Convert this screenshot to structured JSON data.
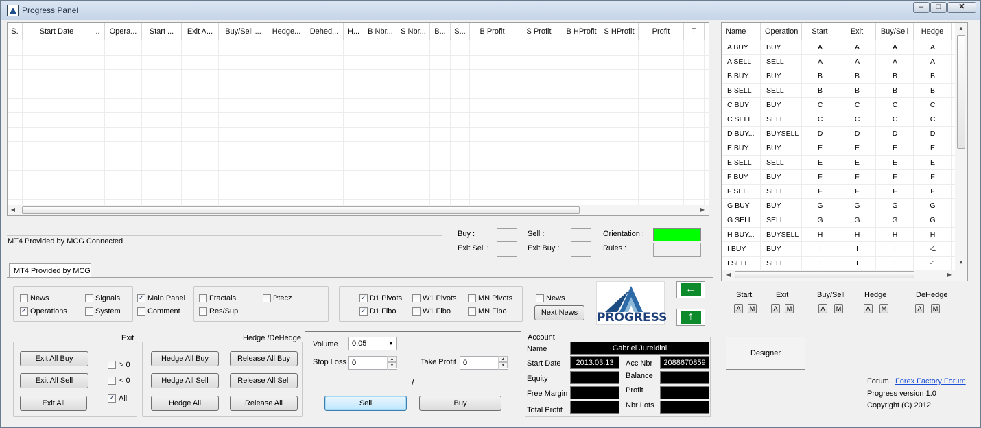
{
  "window": {
    "title": "Progress Panel"
  },
  "positions_grid": {
    "columns": [
      "S.",
      "Start Date",
      "..",
      "Opera...",
      "Start ...",
      "Exit A...",
      "Buy/Sell ...",
      "Hedge...",
      "Dehed...",
      "H...",
      "B Nbr...",
      "S Nbr...",
      "B...",
      "S...",
      "B Profit",
      "S Profit",
      "B HProfit",
      "S HProfit",
      "Profit",
      "T"
    ]
  },
  "rules_grid": {
    "columns": [
      "Name",
      "Operation",
      "Start",
      "Exit",
      "Buy/Sell",
      "Hedge"
    ],
    "rows": [
      [
        "A BUY",
        "BUY",
        "A",
        "A",
        "A",
        "A"
      ],
      [
        "A SELL",
        "SELL",
        "A",
        "A",
        "A",
        "A"
      ],
      [
        "B BUY",
        "BUY",
        "B",
        "B",
        "B",
        "B"
      ],
      [
        "B SELL",
        "SELL",
        "B",
        "B",
        "B",
        "B"
      ],
      [
        "C BUY",
        "BUY",
        "C",
        "C",
        "C",
        "C"
      ],
      [
        "C SELL",
        "SELL",
        "C",
        "C",
        "C",
        "C"
      ],
      [
        "D BUY...",
        "BUYSELL",
        "D",
        "D",
        "D",
        "D"
      ],
      [
        "E BUY",
        "BUY",
        "E",
        "E",
        "E",
        "E"
      ],
      [
        "E SELL",
        "SELL",
        "E",
        "E",
        "E",
        "E"
      ],
      [
        "F BUY",
        "BUY",
        "F",
        "F",
        "F",
        "F"
      ],
      [
        "F SELL",
        "SELL",
        "F",
        "F",
        "F",
        "F"
      ],
      [
        "G BUY",
        "BUY",
        "G",
        "G",
        "G",
        "G"
      ],
      [
        "G SELL",
        "SELL",
        "G",
        "G",
        "G",
        "G"
      ],
      [
        "H BUY...",
        "BUYSELL",
        "H",
        "H",
        "H",
        "H"
      ],
      [
        "I BUY",
        "BUY",
        "I",
        "I",
        "I",
        "-1"
      ],
      [
        "I SELL",
        "SELL",
        "I",
        "I",
        "I",
        "-1"
      ]
    ]
  },
  "status": {
    "connection": "MT4 Provided by MCG Connected"
  },
  "indicators": {
    "buy": "Buy :",
    "sell": "Sell :",
    "exit_sell": "Exit Sell :",
    "exit_buy": "Exit Buy :",
    "orientation": "Orientation :",
    "rules": "Rules :",
    "orientation_color": "#00ff00"
  },
  "tab": {
    "label": "MT4 Provided by MCG"
  },
  "options": {
    "news": {
      "label": "News",
      "checked": false
    },
    "signals": {
      "label": "Signals",
      "checked": false
    },
    "operations": {
      "label": "Operations",
      "checked": true
    },
    "system": {
      "label": "System",
      "checked": false
    },
    "main_panel": {
      "label": "Main Panel",
      "checked": true
    },
    "comment": {
      "label": "Comment",
      "checked": false
    },
    "fractals": {
      "label": "Fractals",
      "checked": false
    },
    "ptecz": {
      "label": "Ptecz",
      "checked": false
    },
    "res_sup": {
      "label": "Res/Sup",
      "checked": false
    },
    "d1_pivots": {
      "label": "D1 Pivots",
      "checked": true
    },
    "w1_pivots": {
      "label": "W1 Pivots",
      "checked": false
    },
    "mn_pivots": {
      "label": "MN Pivots",
      "checked": false
    },
    "d1_fibo": {
      "label": "D1 Fibo",
      "checked": true
    },
    "w1_fibo": {
      "label": "W1 Fibo",
      "checked": false
    },
    "mn_fibo": {
      "label": "MN Fibo",
      "checked": false
    },
    "news2": {
      "label": "News",
      "checked": false
    },
    "next_news": "Next News"
  },
  "logo": {
    "text": "PROGRESS"
  },
  "mini_controls": {
    "labels": [
      "Start",
      "Exit",
      "Buy/Sell",
      "Hedge",
      "DeHedge"
    ],
    "a": "A",
    "m": "M"
  },
  "exit_group": {
    "title": "Exit",
    "exit_all_buy": "Exit All Buy",
    "exit_all_sell": "Exit All Sell",
    "exit_all": "Exit All",
    "gt0": {
      "label": "> 0",
      "checked": false
    },
    "lt0": {
      "label": "< 0",
      "checked": false
    },
    "all": {
      "label": "All",
      "checked": true
    }
  },
  "hedge_group": {
    "title": "Hedge /DeHedge",
    "hedge_all_buy": "Hedge All Buy",
    "release_all_buy": "Release All Buy",
    "hedge_all_sell": "Hedge All Sell",
    "release_all_sell": "Release All Sell",
    "hedge_all": "Hedge All",
    "release_all": "Release All"
  },
  "order": {
    "volume_label": "Volume",
    "volume": "0.05",
    "stop_loss_label": "Stop Loss",
    "stop_loss": "0",
    "take_profit_label": "Take Profit",
    "take_profit": "0",
    "separator": "/",
    "sell": "Sell",
    "buy": "Buy"
  },
  "account": {
    "title": "Account",
    "name_label": "Name",
    "name": "Gabriel Jureidini",
    "start_date_label": "Start Date",
    "start_date": "2013.03.13",
    "acc_nbr_label": "Acc Nbr",
    "acc_nbr": "2088670859",
    "equity_label": "Equity",
    "balance_label": "Balance",
    "free_margin_label": "Free Margin",
    "profit_label": "Profit",
    "total_profit_label": "Total Profit",
    "nbr_lots_label": "Nbr Lots"
  },
  "designer": {
    "label": "Designer"
  },
  "footer": {
    "forum_label": "Forum",
    "forum_link": "Forex Factory Forum",
    "version": "Progress version 1.0",
    "copyright": "Copyright (C) 2012"
  }
}
